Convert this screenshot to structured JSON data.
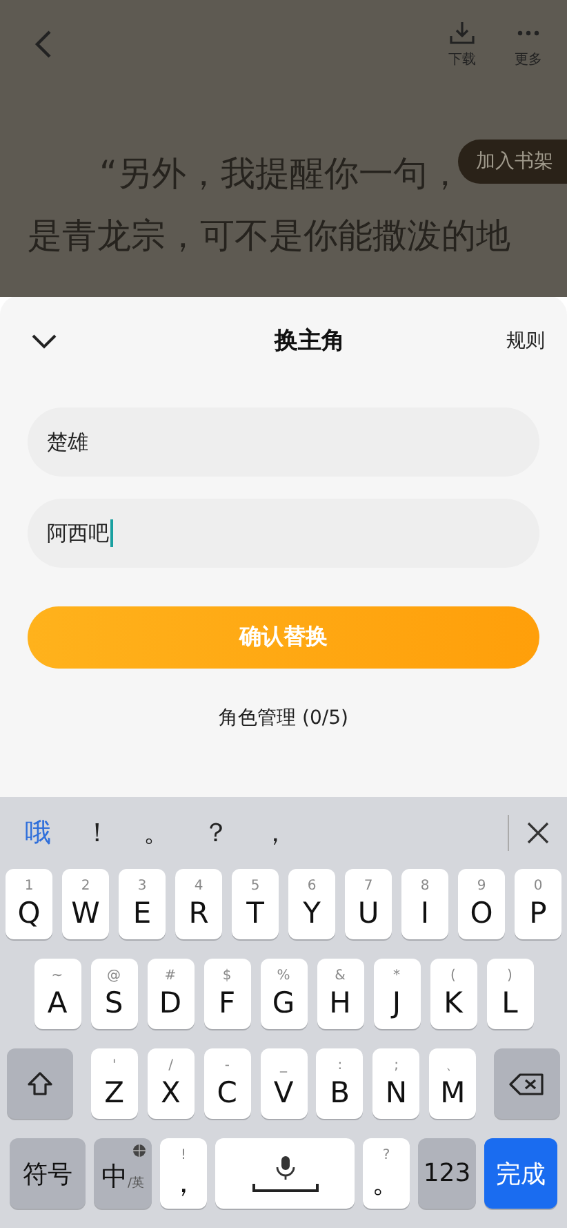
{
  "reader": {
    "actions": [
      {
        "kind": "download",
        "label": "下载"
      },
      {
        "kind": "more",
        "label": "更多"
      }
    ],
    "lines": [
      "“另外，我提醒你一句，",
      "是青龙宗，可不是你能撒泼的地"
    ],
    "shelf_badge": "加入书架"
  },
  "sheet": {
    "title": "换主角",
    "rules_link": "规则",
    "fields": [
      {
        "value": "楚雄",
        "focused": false
      },
      {
        "value": "阿西吧",
        "focused": true
      }
    ],
    "confirm_button": "确认替换",
    "manage_link": "角色管理 (0/5)"
  },
  "keyboard": {
    "candidates": [
      {
        "text": "哦",
        "selected": true
      },
      {
        "text": "！",
        "selected": false
      },
      {
        "text": "。",
        "selected": false
      },
      {
        "text": "？",
        "selected": false
      },
      {
        "text": "，",
        "selected": false
      }
    ],
    "key_rows": [
      {
        "keys": [
          {
            "kind": "char",
            "label": "Q",
            "hint": "1"
          },
          {
            "kind": "char",
            "label": "W",
            "hint": "2"
          },
          {
            "kind": "char",
            "label": "E",
            "hint": "3"
          },
          {
            "kind": "char",
            "label": "R",
            "hint": "4"
          },
          {
            "kind": "char",
            "label": "T",
            "hint": "5"
          },
          {
            "kind": "char",
            "label": "Y",
            "hint": "6"
          },
          {
            "kind": "char",
            "label": "U",
            "hint": "7"
          },
          {
            "kind": "char",
            "label": "I",
            "hint": "8"
          },
          {
            "kind": "char",
            "label": "O",
            "hint": "9"
          },
          {
            "kind": "char",
            "label": "P",
            "hint": "0"
          }
        ]
      },
      {
        "keys": [
          {
            "kind": "char",
            "label": "A",
            "hint": "~"
          },
          {
            "kind": "char",
            "label": "S",
            "hint": "@"
          },
          {
            "kind": "char",
            "label": "D",
            "hint": "#"
          },
          {
            "kind": "char",
            "label": "F",
            "hint": "$"
          },
          {
            "kind": "char",
            "label": "G",
            "hint": "%"
          },
          {
            "kind": "char",
            "label": "H",
            "hint": "&"
          },
          {
            "kind": "char",
            "label": "J",
            "hint": "*"
          },
          {
            "kind": "char",
            "label": "K",
            "hint": "("
          },
          {
            "kind": "char",
            "label": "L",
            "hint": ")"
          }
        ]
      },
      {
        "keys": [
          {
            "kind": "shift"
          },
          {
            "kind": "char",
            "label": "Z",
            "hint": "'"
          },
          {
            "kind": "char",
            "label": "X",
            "hint": "/"
          },
          {
            "kind": "char",
            "label": "C",
            "hint": "-"
          },
          {
            "kind": "char",
            "label": "V",
            "hint": "_"
          },
          {
            "kind": "char",
            "label": "B",
            "hint": ":"
          },
          {
            "kind": "char",
            "label": "N",
            "hint": ";"
          },
          {
            "kind": "char",
            "label": "M",
            "hint": "、"
          },
          {
            "kind": "delete"
          }
        ]
      },
      {
        "keys": [
          {
            "kind": "func",
            "label": "符号"
          },
          {
            "kind": "lang",
            "label": "中",
            "sub": "/英"
          },
          {
            "kind": "char",
            "label": "，",
            "hint": "!"
          },
          {
            "kind": "space"
          },
          {
            "kind": "char",
            "label": "。",
            "hint": "?"
          },
          {
            "kind": "func",
            "label": "123"
          },
          {
            "kind": "done",
            "label": "完成"
          }
        ]
      }
    ]
  }
}
